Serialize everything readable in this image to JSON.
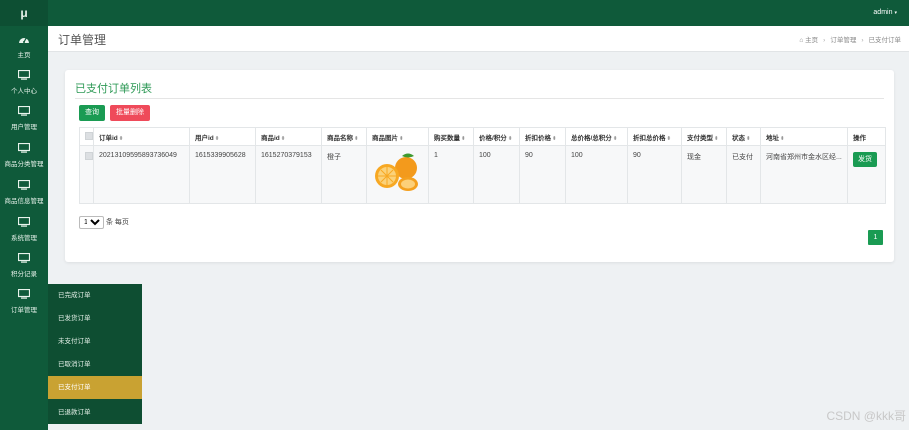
{
  "app": {
    "logo_text": "μ",
    "user_label": "admin",
    "caret": "▾"
  },
  "sidebar": {
    "items": [
      {
        "label": "主页",
        "icon": "dashboard-icon"
      },
      {
        "label": "个人中心",
        "icon": "monitor-icon"
      },
      {
        "label": "用户管理",
        "icon": "monitor-icon"
      },
      {
        "label": "商品分类管理",
        "icon": "monitor-icon"
      },
      {
        "label": "商品信息管理",
        "icon": "monitor-icon"
      },
      {
        "label": "系统管理",
        "icon": "monitor-icon"
      },
      {
        "label": "积分记录",
        "icon": "monitor-icon"
      },
      {
        "label": "订单管理",
        "icon": "monitor-icon"
      }
    ],
    "submenu": [
      {
        "label": "已完成订单",
        "active": false
      },
      {
        "label": "已发货订单",
        "active": false
      },
      {
        "label": "未支付订单",
        "active": false
      },
      {
        "label": "已取消订单",
        "active": false
      },
      {
        "label": "已支付订单",
        "active": true
      },
      {
        "label": "已退款订单",
        "active": false
      }
    ]
  },
  "header": {
    "title": "订单管理",
    "breadcrumb": {
      "home": "主页",
      "parent": "订单管理",
      "current": "已支付订单",
      "separator": "›"
    }
  },
  "main": {
    "card_title": "已支付订单列表",
    "query_button": "查询",
    "batch_delete_button": "批量删除",
    "columns": [
      "订单id",
      "用户id",
      "商品id",
      "商品名称",
      "商品图片",
      "购买数量",
      "价格/积分",
      "折扣价格",
      "总价格/总积分",
      "折扣总价格",
      "支付类型",
      "状态",
      "地址",
      "操作"
    ],
    "sort_marker": "⬍",
    "rows": [
      {
        "order_id": "20213109595893736049",
        "user_id": "1615339905628",
        "product_id": "1615270379153",
        "product_name": "橙子",
        "image": "orange-image",
        "quantity": "1",
        "price": "100",
        "discount_price": "90",
        "total_price": "100",
        "discount_total": "90",
        "pay_type": "现金",
        "status": "已支付",
        "address": "河南省郑州市金水区经...",
        "action": "发货"
      }
    ],
    "page_size": "10",
    "page_size_suffix": "条 每页",
    "current_page": "1"
  },
  "watermark": "CSDN @kkk哥",
  "colors": {
    "brand_green": "#0f5a3a",
    "accent_green": "#1a9b53",
    "danger": "#ef4a5a",
    "active_submenu": "#c9a232"
  }
}
